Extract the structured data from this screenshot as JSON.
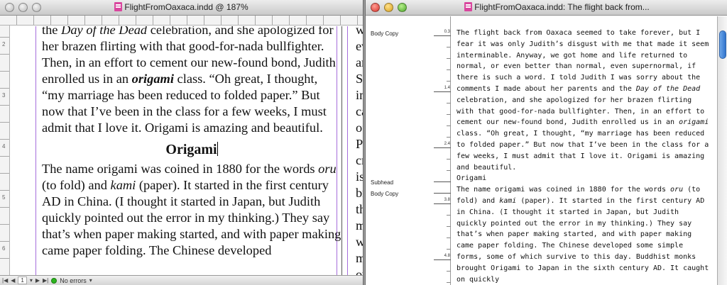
{
  "layout_window": {
    "title": "FlightFromOaxaca.indd @ 187%",
    "ruler_numbers": [
      "2",
      "3",
      "4",
      "5",
      "6"
    ],
    "paragraph1": {
      "t1": "the ",
      "t2": "Day of the Dead",
      "t3": " celebration, and she apologized for her brazen flirting with that good-for-nada bullfighter. Then, in an effort to cement our new-found bond, Judith enrolled us in an ",
      "t4": "origami",
      "t5": " class. “Oh great, I thought, “my marriage has been reduced to folded paper.” But now that I’ve been in the class for a few weeks, I must admit that I love it. Origami is amazing and beautiful."
    },
    "subhead": "Origami",
    "paragraph2": {
      "t1": "The name origami was coined in 1880 for the words ",
      "t2": "oru",
      "t3": " (to fold) and ",
      "t4": "kami",
      "t5": " (paper). It started in the first century AD in China. (I thought it started in Japan, but Judith quickly pointed out the error in my thinking.) They say that’s when paper making started, and with paper making came paper folding. The Chinese developed"
    },
    "next_column_lines": [
      "we",
      "ev",
      "ar",
      "Sp",
      "in",
      "ca",
      "of",
      "Po",
      "cra",
      "is",
      "br",
      "th",
      "m",
      "wh",
      "m",
      "ov"
    ],
    "status": {
      "page": "1",
      "zoom_label": "187%",
      "errors": "No errors"
    }
  },
  "story_window": {
    "title": "FlightFromOaxaca.indd: The flight back from...",
    "styles": {
      "body_copy_1": "Body Copy",
      "subhead": "Subhead",
      "body_copy_2": "Body Copy"
    },
    "depth_labels": [
      "0.3",
      "1.4",
      "2.4",
      "3.8",
      "4.8"
    ],
    "text": {
      "p1a": "The flight back from Oaxaca seemed to take forever, but I fear it was only Judith’s disgust with me that made it seem interminable. Anyway, we got home and life returned to normal, or even better than normal, even supernormal, if there is such a word. I told Judith I was sorry about the comments I made about her parents and the ",
      "p1b": "Day of the Dead",
      "p1c": " celebration, and she apologized for her brazen flirting with that good-for-nada bullfighter. Then, in an effort to cement our new-found bond, Judith enrolled us in an ",
      "p1d": "origami",
      "p1e": " class. “Oh great, I thought, “my marriage has been reduced to folded paper.” But now that I’ve been in the class for a few weeks, I must admit that I love it. Origami is amazing and beautiful.",
      "subhead": "Origami",
      "p2a": "The name origami was coined in 1880 for the words ",
      "p2b": "oru",
      "p2c": " (to fold) and ",
      "p2d": "kami",
      "p2e": " (paper). It started in the first century AD in China. (I thought it started in Japan, but Judith quickly pointed out the error in my thinking.) They say that’s when paper making started, and with paper making came paper folding. The Chinese developed some simple forms, some of which survive to this day. Buddhist monks brought Origami to Japan in the sixth century AD. It caught on quickly"
    }
  }
}
